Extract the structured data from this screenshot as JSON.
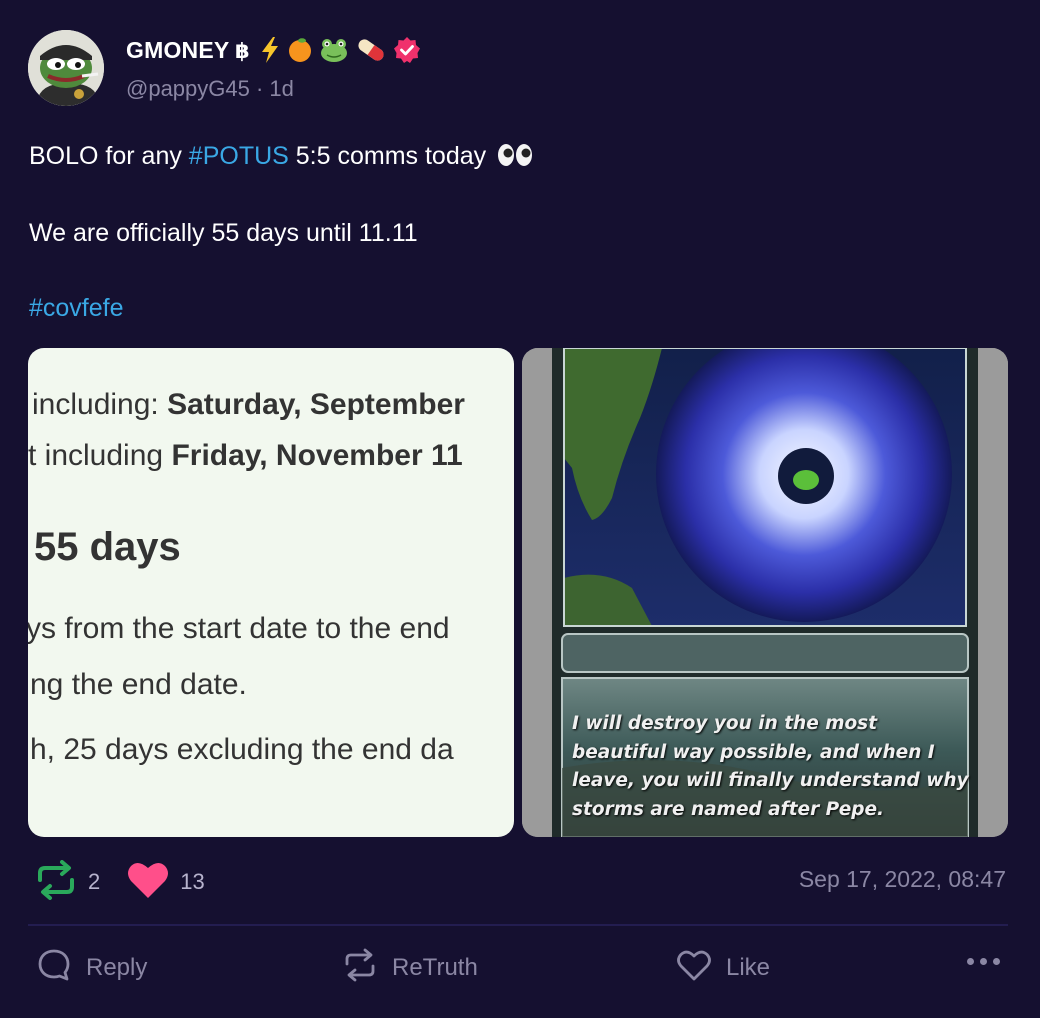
{
  "post": {
    "author": {
      "display_name": "GMONEY",
      "emoji_icons": [
        "bitcoin-baht-icon",
        "lightning-icon",
        "orange-icon",
        "frog-icon",
        "pill-icon"
      ],
      "verified": true,
      "handle": "@pappyG45",
      "age": "· 1d"
    },
    "text": {
      "line1_pre": "BOLO for any ",
      "line1_hashtag": "#POTUS",
      "line1_post": " 5:5 comms today",
      "line1_emoji": "eyes-icon",
      "line2": "We are officially 55 days until 11.11",
      "line3_hashtag": "#covfefe"
    },
    "images": {
      "left": {
        "line1_pre": "including: ",
        "line1_bold": "Saturday, September",
        "line2_pre": "t including ",
        "line2_bold": "Friday, November 11",
        "heading": "55 days",
        "line3": "ys from the start date to the end",
        "line4": "ng the end date.",
        "line5": "h, 25 days excluding the end da"
      },
      "right": {
        "caption": "I will destroy you in the most beautiful way possible, and when I leave, you will finally understand why storms are named after Pepe."
      }
    },
    "stats": {
      "retruths": "2",
      "likes": "13"
    },
    "timestamp": "Sep 17, 2022, 08:47",
    "actions": {
      "reply": "Reply",
      "retruth": "ReTruth",
      "like": "Like"
    }
  },
  "colors": {
    "background": "#151030",
    "hashtag": "#3aa8e5",
    "muted": "#8b87a4",
    "retruth_green": "#2aa95b",
    "like_pink": "#ff4f8a",
    "verified_badge": "#f0316c"
  }
}
